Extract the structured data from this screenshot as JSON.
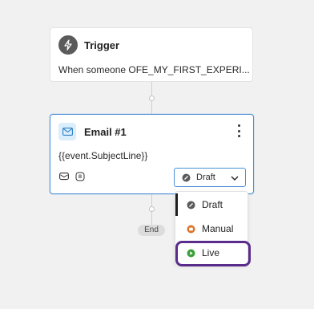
{
  "trigger": {
    "title": "Trigger",
    "description": "When someone OFE_MY_FIRST_EXPERI..."
  },
  "email": {
    "title": "Email #1",
    "subject": "{{event.SubjectLine}}",
    "status": "Draft"
  },
  "end": {
    "label": "End"
  },
  "status_dropdown": {
    "options": [
      {
        "label": "Draft",
        "color": "#555555",
        "selected": true
      },
      {
        "label": "Manual",
        "color": "#d9742a",
        "selected": false
      },
      {
        "label": "Live",
        "color": "#3aa13a",
        "selected": false
      }
    ]
  },
  "colors": {
    "accent_border": "#4a90d9",
    "highlight": "#5a2d8c",
    "email_icon_bg": "#dbeefb"
  },
  "icons": {
    "trigger": "lightning-icon",
    "email": "envelope-icon",
    "kebab": "kebab-menu-icon",
    "message_preview": "message-icon",
    "attachment": "attachment-icon",
    "chevron": "chevron-down-icon"
  }
}
